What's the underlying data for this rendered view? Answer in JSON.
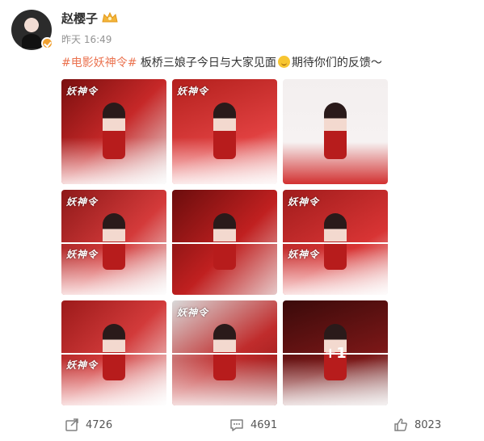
{
  "post": {
    "username": "赵樱子",
    "timestamp": "昨天 16:49",
    "hashtag": "#电影妖神令#",
    "text_before_emoji": " 板桥三娘子今日与大家见面",
    "text_after_emoji": "期待你们的反馈～",
    "emoji": "smile-emoji"
  },
  "images": {
    "logo_text": "妖神令",
    "more_badge": "+1",
    "items": [
      {
        "name": "photo-1"
      },
      {
        "name": "photo-2"
      },
      {
        "name": "photo-3"
      },
      {
        "name": "photo-4"
      },
      {
        "name": "photo-5"
      },
      {
        "name": "photo-6"
      },
      {
        "name": "photo-7"
      },
      {
        "name": "photo-8"
      },
      {
        "name": "photo-9"
      }
    ]
  },
  "actions": {
    "forward_count": "4726",
    "comment_count": "4691",
    "like_count": "8023",
    "forward_icon": "share-icon",
    "comment_icon": "comment-icon",
    "like_icon": "thumbs-up-icon"
  },
  "colors": {
    "hashtag": "#eb7350",
    "verified_badge": "#f0a030",
    "icon_gray": "#808080"
  }
}
